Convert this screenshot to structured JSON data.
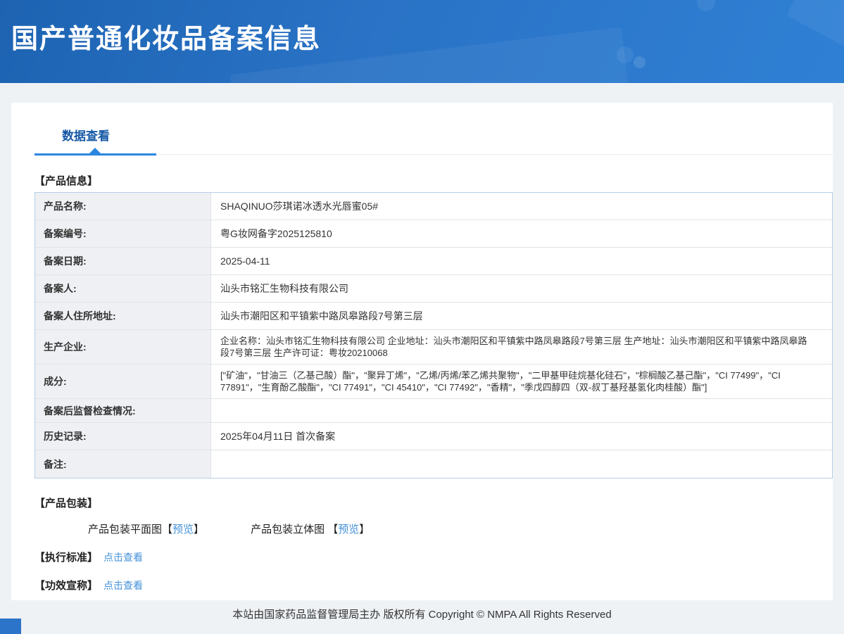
{
  "page": {
    "title": "国产普通化妆品备案信息",
    "tab": "数据查看",
    "footer": "本站由国家药品监督管理局主办 版权所有 Copyright © NMPA All Rights Reserved"
  },
  "colors": {
    "header_gradient_start": "#1d63b2",
    "header_gradient_end": "#2f80d5",
    "tab_text": "#1659a6",
    "tab_underline": "#2b86e0",
    "link": "#4392d9",
    "label_cell_bg": "#eef0f3",
    "table_border": "#b5cee6",
    "page_bg": "#eff2f5"
  },
  "product_info": {
    "section_title": "【产品信息】",
    "rows": [
      {
        "label": "产品名称:",
        "value": "SHAQINUO莎琪诺冰透水光唇蜜05#"
      },
      {
        "label": "备案编号:",
        "value": "粤G妆网备字2025125810"
      },
      {
        "label": "备案日期:",
        "value": "2025-04-11"
      },
      {
        "label": "备案人:",
        "value": "汕头市铭汇生物科技有限公司"
      },
      {
        "label": "备案人住所地址:",
        "value": "汕头市潮阳区和平镇紫中路凤皋路段7号第三层"
      },
      {
        "label": "生产企业:",
        "value": "企业名称：汕头市铭汇生物科技有限公司 企业地址：汕头市潮阳区和平镇紫中路凤皋路段7号第三层 生产地址：汕头市潮阳区和平镇紫中路凤皋路段7号第三层 生产许可证：粤妆20210068"
      },
      {
        "label": "成分:",
        "value": "[\"矿油\"，\"甘油三（乙基己酸）酯\"，\"聚异丁烯\"，\"乙烯/丙烯/苯乙烯共聚物\"，\"二甲基甲硅烷基化硅石\"，\"棕榈酸乙基己酯\"，\"CI 77499\"，\"CI 77891\"，\"生育酚乙酸酯\"，\"CI 77491\"，\"CI 45410\"，\"CI 77492\"，\"香精\"，\"季戊四醇四（双-叔丁基羟基氢化肉桂酸）酯\"]"
      },
      {
        "label": "备案后监督检查情况:",
        "value": ""
      },
      {
        "label": "历史记录:",
        "value": "2025年04月11日 首次备案"
      },
      {
        "label": "备注:",
        "value": ""
      }
    ]
  },
  "packaging": {
    "section_title": "【产品包装】",
    "flat_label": "产品包装平面图",
    "flat_bracket_open": "【",
    "flat_link": "预览",
    "flat_bracket_close": "】",
    "stereo_label": "产品包装立体图",
    "stereo_bracket_open": " 【",
    "stereo_link": "预览",
    "stereo_bracket_close": "】"
  },
  "standard": {
    "section_title": "【执行标准】",
    "link": "点击查看"
  },
  "efficacy": {
    "section_title": "【功效宣称】",
    "link": "点击查看"
  }
}
